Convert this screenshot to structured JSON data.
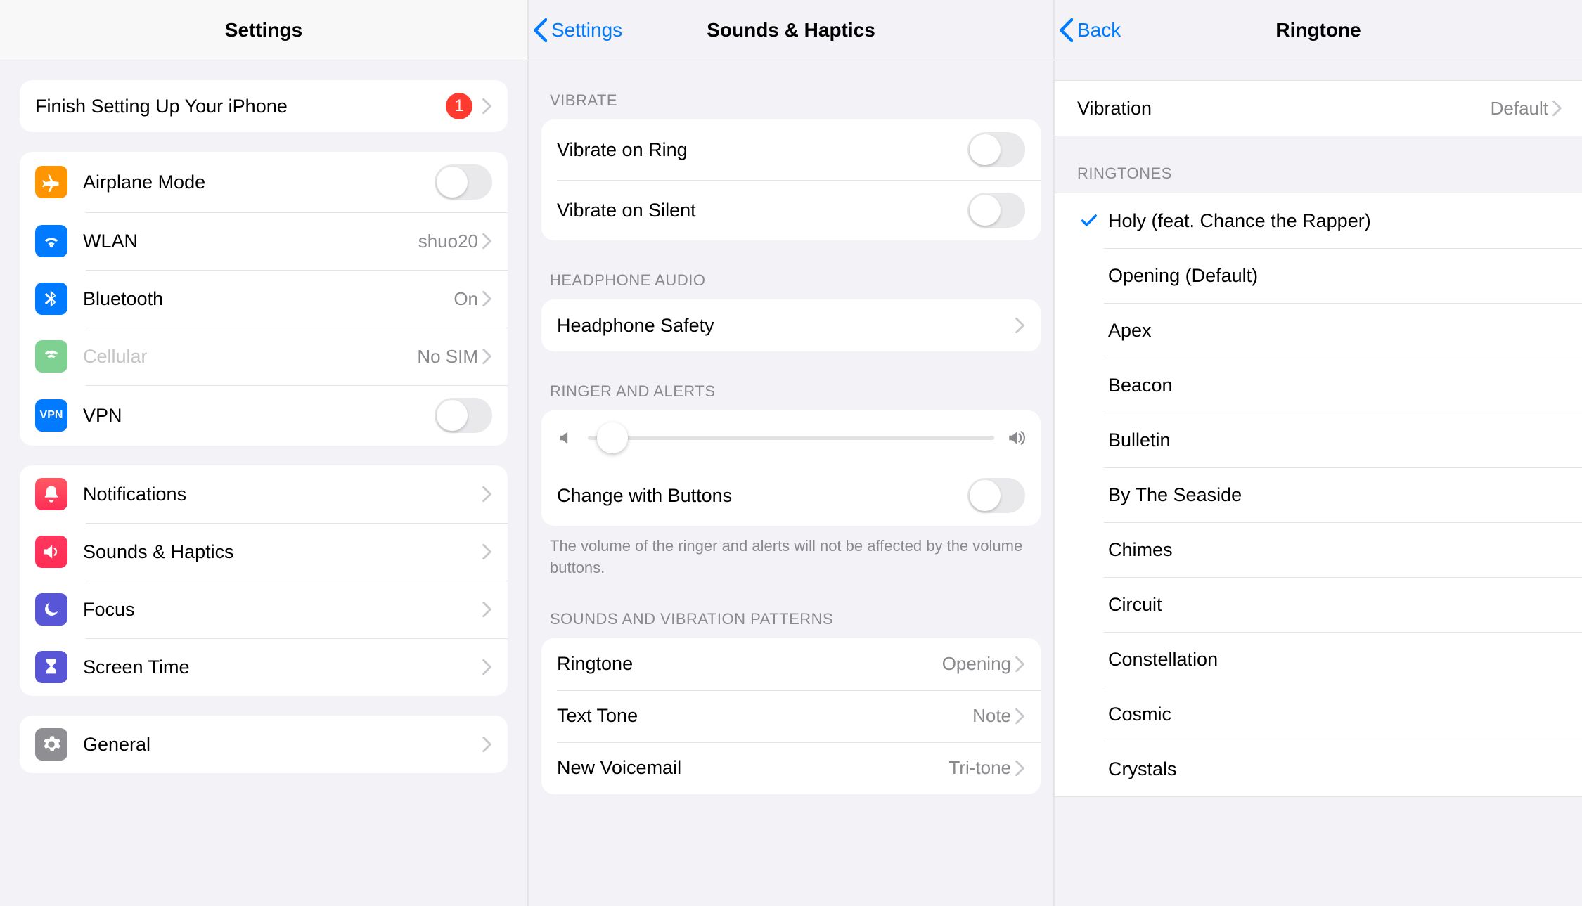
{
  "col1": {
    "title": "Settings",
    "finish": {
      "label": "Finish Setting Up Your iPhone",
      "badge": "1"
    },
    "net": {
      "airplane": "Airplane Mode",
      "wlan": "WLAN",
      "wlan_detail": "shuo20",
      "bluetooth": "Bluetooth",
      "bluetooth_detail": "On",
      "cellular": "Cellular",
      "cellular_detail": "No SIM",
      "vpn": "VPN"
    },
    "sys": {
      "notifications": "Notifications",
      "sounds": "Sounds & Haptics",
      "focus": "Focus",
      "screentime": "Screen Time"
    },
    "gen": {
      "general": "General"
    }
  },
  "col2": {
    "back": "Settings",
    "title": "Sounds & Haptics",
    "vibrate_header": "Vibrate",
    "vibrate_ring": "Vibrate on Ring",
    "vibrate_silent": "Vibrate on Silent",
    "headphone_header": "Headphone Audio",
    "headphone_safety": "Headphone Safety",
    "ringer_header": "Ringer and Alerts",
    "change_buttons": "Change with Buttons",
    "ringer_footer": "The volume of the ringer and alerts will not be affected by the volume buttons.",
    "patterns_header": "Sounds and Vibration Patterns",
    "ringtone": "Ringtone",
    "ringtone_val": "Opening",
    "texttone": "Text Tone",
    "texttone_val": "Note",
    "voicemail": "New Voicemail",
    "voicemail_val": "Tri-tone"
  },
  "col3": {
    "back": "Back",
    "title": "Ringtone",
    "vibration": "Vibration",
    "vibration_val": "Default",
    "ringtones_header": "Ringtones",
    "items": [
      "Holy (feat. Chance the Rapper)",
      "Opening (Default)",
      "Apex",
      "Beacon",
      "Bulletin",
      "By The Seaside",
      "Chimes",
      "Circuit",
      "Constellation",
      "Cosmic",
      "Crystals"
    ],
    "selected_index": 0
  }
}
